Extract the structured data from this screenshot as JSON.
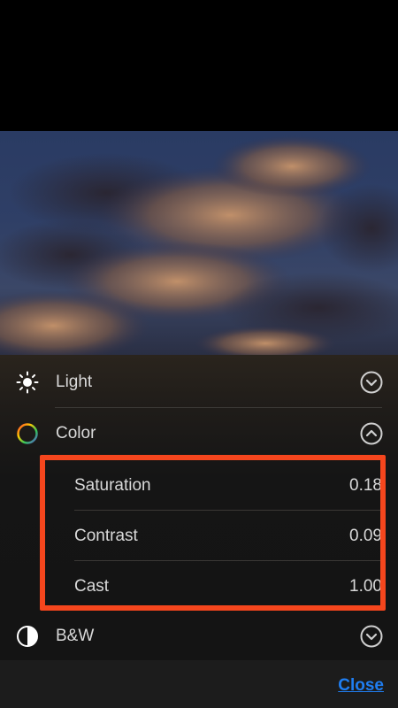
{
  "adjustments": {
    "light": {
      "label": "Light",
      "icon": "sun-icon",
      "chevron": "chevron-down-icon"
    },
    "color": {
      "label": "Color",
      "icon": "color-wheel-icon",
      "chevron": "chevron-up-icon",
      "sliders": [
        {
          "label": "Saturation",
          "value": "0.18"
        },
        {
          "label": "Contrast",
          "value": "0.09"
        },
        {
          "label": "Cast",
          "value": "1.00"
        }
      ]
    },
    "bw": {
      "label": "B&W",
      "icon": "half-circle-icon",
      "chevron": "chevron-down-icon"
    }
  },
  "footer": {
    "close_label": "Close"
  },
  "colors": {
    "highlight": "#f5461d",
    "link": "#1f7ef2"
  }
}
